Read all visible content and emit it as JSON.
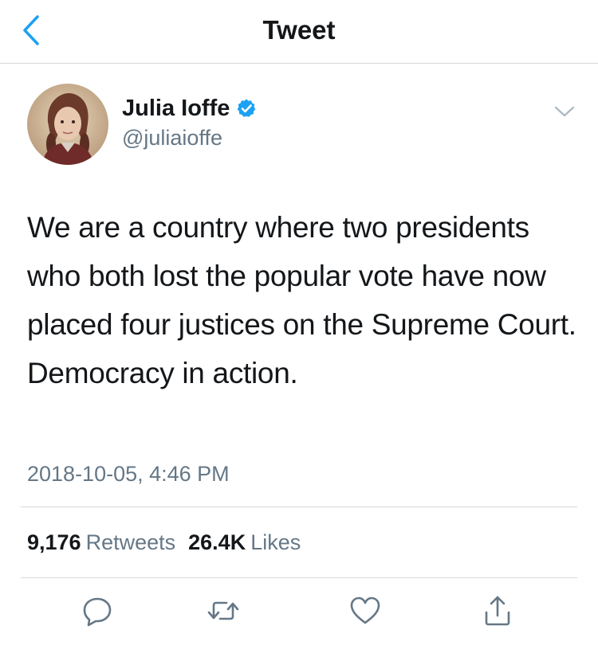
{
  "nav": {
    "title": "Tweet",
    "back_icon": "chevron-left-icon"
  },
  "tweet": {
    "author": {
      "name": "Julia Ioffe",
      "handle": "@juliaioffe",
      "verified": true,
      "verified_color": "#1da1f2"
    },
    "text": "We are a country where two presidents who both lost the popular vote have now placed four justices on the Supreme Court. Democracy in action.",
    "timestamp": "2018-10-05, 4:46 PM",
    "stats": {
      "retweets_count": "9,176",
      "retweets_label": "Retweets",
      "likes_count": "26.4K",
      "likes_label": "Likes"
    },
    "actions": [
      "reply-icon",
      "retweet-icon",
      "like-icon",
      "share-icon"
    ]
  },
  "colors": {
    "accent": "#1da1f2",
    "text": "#14171a",
    "muted": "#657786",
    "divider": "#d5d9dd"
  }
}
